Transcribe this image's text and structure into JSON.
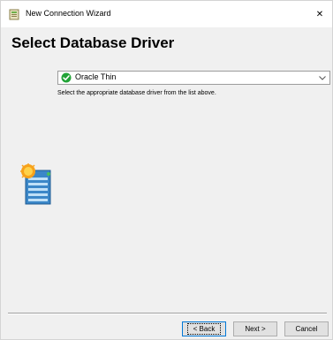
{
  "window": {
    "title": "New Connection Wizard",
    "close_glyph": "✕"
  },
  "header": {
    "title": "Select Database Driver"
  },
  "driver": {
    "selected": "Oracle Thin",
    "status_icon": "green-check-icon",
    "hint": "Select the appropriate database driver from the list above."
  },
  "buttons": {
    "back": "< Back",
    "next": "Next >",
    "cancel": "Cancel"
  },
  "colors": {
    "check_green": "#21a336",
    "db_blue": "#3b87c8",
    "db_orange": "#f7a21b",
    "focus_blue": "#0078d7"
  }
}
